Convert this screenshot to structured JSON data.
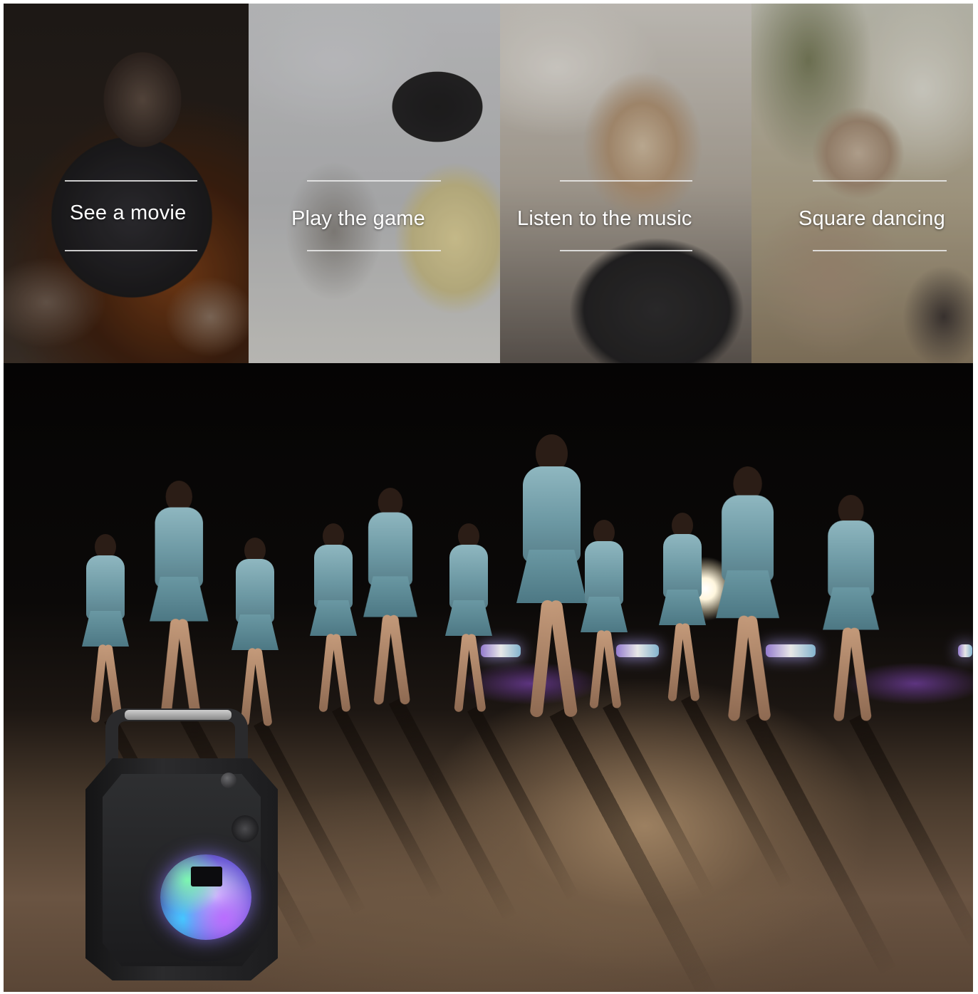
{
  "panels": [
    {
      "id": "movie",
      "caption": "See a movie"
    },
    {
      "id": "game",
      "caption": "Play the game"
    },
    {
      "id": "music",
      "caption": "Listen to the music"
    },
    {
      "id": "dance",
      "caption": "Square dancing"
    }
  ],
  "colors": {
    "caption_text": "#ffffff",
    "rule": "#ebebeb",
    "night_sky": "#050404",
    "dress": "#6b97a2"
  }
}
